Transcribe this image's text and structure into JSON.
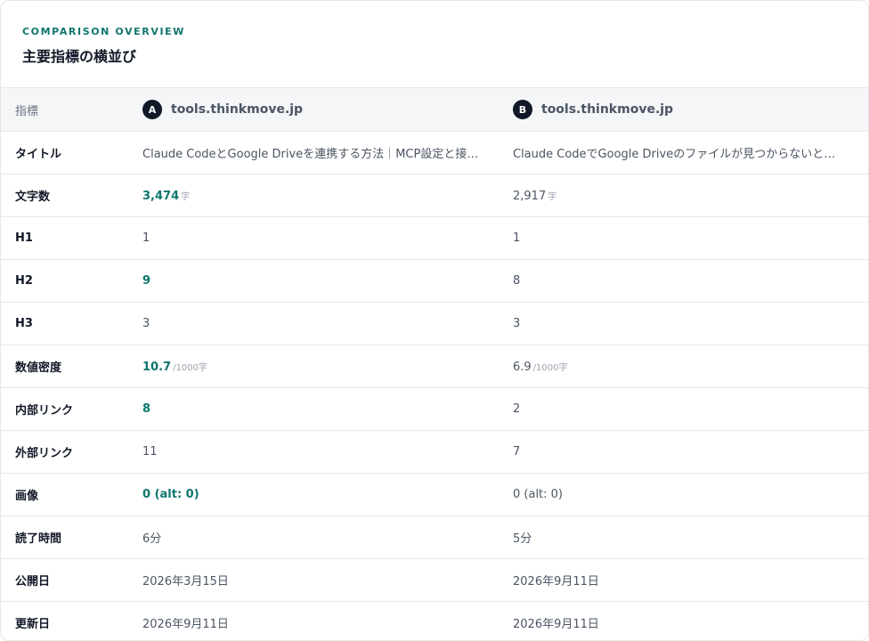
{
  "header": {
    "eyebrow": "COMPARISON OVERVIEW",
    "title": "主要指標の横並び"
  },
  "columns": {
    "metric_label": "指標",
    "a": {
      "badge": "A",
      "domain": "tools.thinkmove.jp"
    },
    "b": {
      "badge": "B",
      "domain": "tools.thinkmove.jp"
    }
  },
  "colors": {
    "accent": "#0f766e",
    "badge_bg": "#111827",
    "header_bg": "#f4f6f8"
  },
  "rows": [
    {
      "label": "タイトル",
      "a": {
        "value": "Claude CodeとGoogle Driveを連携する方法｜MCP設定と接続…",
        "unit": "",
        "win": false
      },
      "b": {
        "value": "Claude CodeでGoogle Driveのファイルが見つからないときの…",
        "unit": "",
        "win": false
      }
    },
    {
      "label": "文字数",
      "a": {
        "value": "3,474",
        "unit": "字",
        "win": true
      },
      "b": {
        "value": "2,917",
        "unit": "字",
        "win": false
      }
    },
    {
      "label": "H1",
      "a": {
        "value": "1",
        "unit": "",
        "win": false
      },
      "b": {
        "value": "1",
        "unit": "",
        "win": false
      }
    },
    {
      "label": "H2",
      "a": {
        "value": "9",
        "unit": "",
        "win": true
      },
      "b": {
        "value": "8",
        "unit": "",
        "win": false
      }
    },
    {
      "label": "H3",
      "a": {
        "value": "3",
        "unit": "",
        "win": false
      },
      "b": {
        "value": "3",
        "unit": "",
        "win": false
      }
    },
    {
      "label": "数値密度",
      "a": {
        "value": "10.7",
        "unit": "/1000字",
        "win": true
      },
      "b": {
        "value": "6.9",
        "unit": "/1000字",
        "win": false
      }
    },
    {
      "label": "内部リンク",
      "a": {
        "value": "8",
        "unit": "",
        "win": true
      },
      "b": {
        "value": "2",
        "unit": "",
        "win": false
      }
    },
    {
      "label": "外部リンク",
      "a": {
        "value": "11",
        "unit": "",
        "win": false
      },
      "b": {
        "value": "7",
        "unit": "",
        "win": false
      }
    },
    {
      "label": "画像",
      "a": {
        "value": "0 (alt: 0)",
        "unit": "",
        "win": true
      },
      "b": {
        "value": "0 (alt: 0)",
        "unit": "",
        "win": false
      }
    },
    {
      "label": "読了時間",
      "a": {
        "value": "6分",
        "unit": "",
        "win": false
      },
      "b": {
        "value": "5分",
        "unit": "",
        "win": false
      }
    },
    {
      "label": "公開日",
      "a": {
        "value": "2026年3月15日",
        "unit": "",
        "win": false
      },
      "b": {
        "value": "2026年9月11日",
        "unit": "",
        "win": false
      }
    },
    {
      "label": "更新日",
      "a": {
        "value": "2026年9月11日",
        "unit": "",
        "win": false
      },
      "b": {
        "value": "2026年9月11日",
        "unit": "",
        "win": false
      }
    }
  ]
}
